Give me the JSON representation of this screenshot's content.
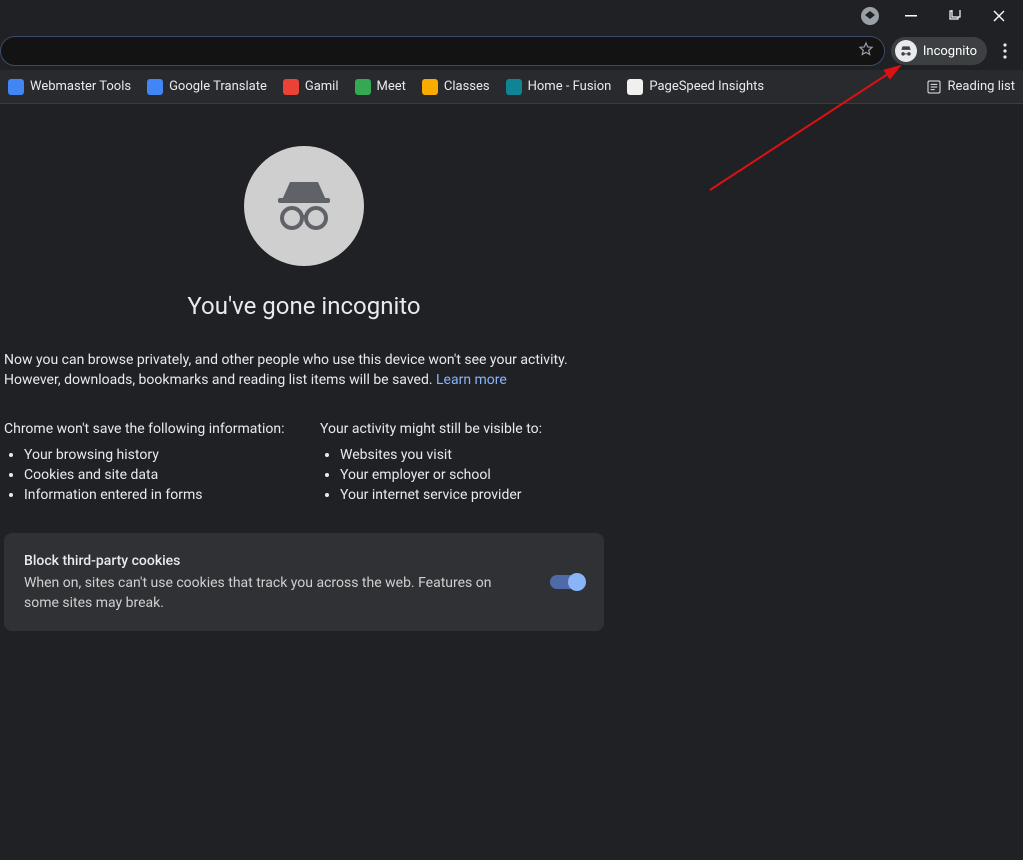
{
  "window": {
    "incognito_chip_label": "Incognito"
  },
  "bookmarks": {
    "items": [
      {
        "label": "Webmaster Tools",
        "color": "#4285f4"
      },
      {
        "label": "Google Translate",
        "color": "#4285f4"
      },
      {
        "label": "Gamil",
        "color": "#ea4335"
      },
      {
        "label": "Meet",
        "color": "#34a853"
      },
      {
        "label": "Classes",
        "color": "#f9ab00"
      },
      {
        "label": "Home - Fusion",
        "color": "#108494"
      },
      {
        "label": "PageSpeed Insights",
        "color": "#f0f0f0"
      }
    ],
    "reading_list_label": "Reading list"
  },
  "page": {
    "title": "You've gone incognito",
    "intro_line1": "Now you can browse privately, and other people who use this device won't see your activity.",
    "intro_line2_prefix": "However, downloads, bookmarks and reading list items will be saved. ",
    "learn_more": "Learn more",
    "col1_head": "Chrome won't save the following information:",
    "col1_items": [
      "Your browsing history",
      "Cookies and site data",
      "Information entered in forms"
    ],
    "col2_head": "Your activity might still be visible to:",
    "col2_items": [
      "Websites you visit",
      "Your employer or school",
      "Your internet service provider"
    ],
    "cookie_title": "Block third-party cookies",
    "cookie_desc": "When on, sites can't use cookies that track you across the web. Features on some sites may break.",
    "cookie_toggle_on": true
  }
}
